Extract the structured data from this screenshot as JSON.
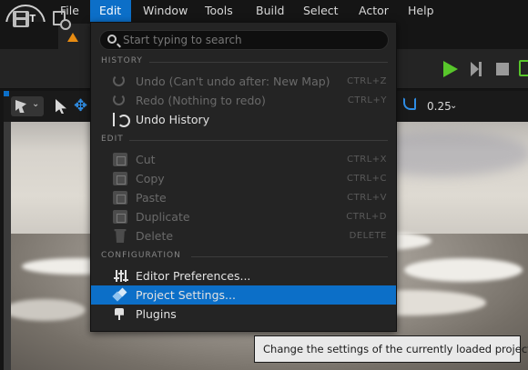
{
  "menubar": {
    "items": [
      {
        "label": "File"
      },
      {
        "label": "Edit"
      },
      {
        "label": "Window"
      },
      {
        "label": "Tools"
      },
      {
        "label": "Build"
      },
      {
        "label": "Select"
      },
      {
        "label": "Actor"
      },
      {
        "label": "Help"
      }
    ],
    "active": "Edit"
  },
  "viewport_toolbar": {
    "snap_value": "0.25"
  },
  "edit_menu": {
    "search": {
      "placeholder": "Start typing to search",
      "value": ""
    },
    "sections": [
      {
        "title": "HISTORY",
        "items": [
          {
            "label": "Undo (Can't undo after: New Map)",
            "shortcut": "CTRL+Z",
            "icon": "undo-icon",
            "enabled": false
          },
          {
            "label": "Redo (Nothing to redo)",
            "shortcut": "CTRL+Y",
            "icon": "redo-icon",
            "enabled": false
          },
          {
            "label": "Undo History",
            "shortcut": "",
            "icon": "history-icon",
            "enabled": true
          }
        ]
      },
      {
        "title": "EDIT",
        "items": [
          {
            "label": "Cut",
            "shortcut": "CTRL+X",
            "icon": "cut-icon",
            "enabled": false
          },
          {
            "label": "Copy",
            "shortcut": "CTRL+C",
            "icon": "copy-icon",
            "enabled": false
          },
          {
            "label": "Paste",
            "shortcut": "CTRL+V",
            "icon": "paste-icon",
            "enabled": false
          },
          {
            "label": "Duplicate",
            "shortcut": "CTRL+D",
            "icon": "duplicate-icon",
            "enabled": false
          },
          {
            "label": "Delete",
            "shortcut": "DELETE",
            "icon": "trash-icon",
            "enabled": false
          }
        ]
      },
      {
        "title": "CONFIGURATION",
        "items": [
          {
            "label": "Editor Preferences...",
            "shortcut": "",
            "icon": "sliders-icon",
            "enabled": true
          },
          {
            "label": "Project Settings...",
            "shortcut": "",
            "icon": "project-settings-icon",
            "enabled": true,
            "highlighted": true
          },
          {
            "label": "Plugins",
            "shortcut": "",
            "icon": "plugin-icon",
            "enabled": true
          }
        ]
      }
    ]
  },
  "tooltip": {
    "text": "Change the settings of the currently loaded project."
  },
  "colors": {
    "accent": "#0c6fc8",
    "play": "#58c62b",
    "level_tab": "#e88c12"
  }
}
